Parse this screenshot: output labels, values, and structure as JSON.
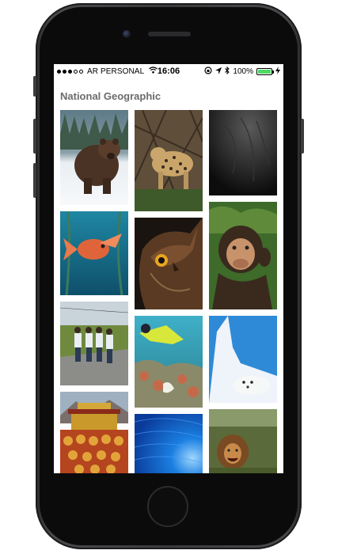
{
  "status_bar": {
    "carrier": "AR PERSONAL",
    "time": "16:06",
    "battery": "100%",
    "battery_level": 1.0,
    "signal_bars_filled": 3,
    "signal_bars_total": 5
  },
  "page": {
    "title": "National Geographic"
  },
  "gallery": {
    "photos": [
      {
        "subject": "bear in snow"
      },
      {
        "subject": "jaguar"
      },
      {
        "subject": "dark water"
      },
      {
        "subject": "red fish underwater"
      },
      {
        "subject": "owl"
      },
      {
        "subject": "chimpanzee"
      },
      {
        "subject": "girls on road"
      },
      {
        "subject": "diver and coral"
      },
      {
        "subject": "seal on ice"
      },
      {
        "subject": "monks at temple"
      },
      {
        "subject": "blue underwater"
      },
      {
        "subject": "lion"
      }
    ]
  },
  "colors": {
    "accent_battery": "#4cd964",
    "title_text": "#6b6b6b"
  }
}
